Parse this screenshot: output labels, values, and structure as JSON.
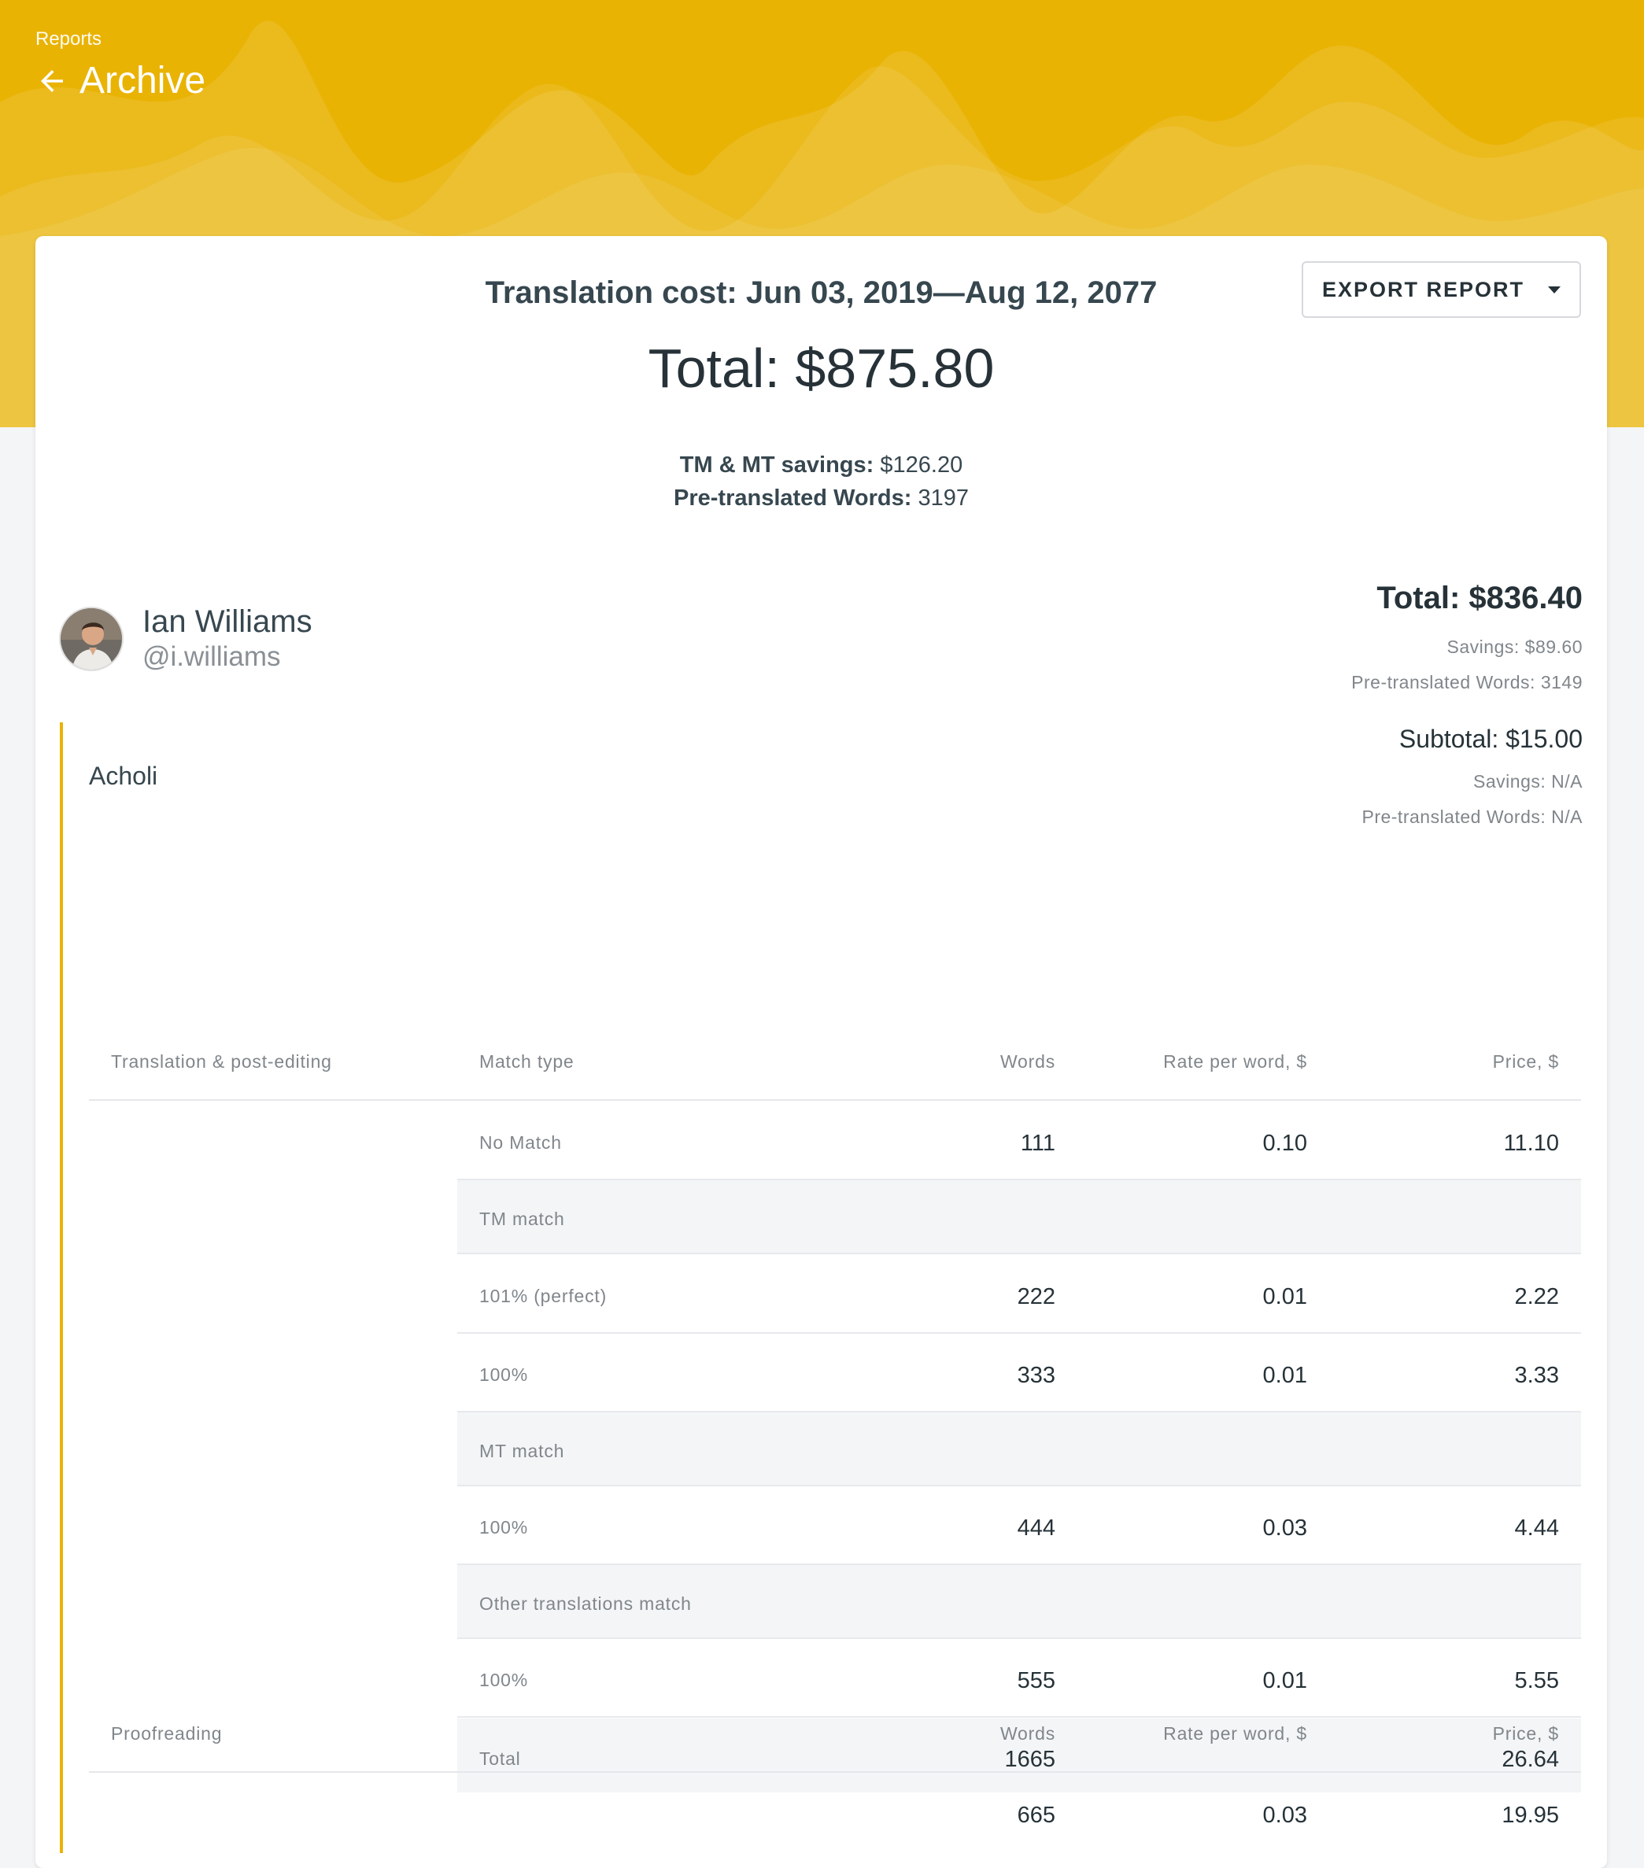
{
  "header": {
    "breadcrumb": "Reports",
    "title": "Archive",
    "accent_color": "#e9b304"
  },
  "report": {
    "export_label": "EXPORT REPORT",
    "cost_title": "Translation cost: Jun 03, 2019—Aug 12, 2077",
    "grand_total": "Total: $875.80",
    "savings_label": "TM & MT savings:",
    "savings_value": " $126.20",
    "pretranslated_label": "Pre-translated Words:",
    "pretranslated_value": " 3197"
  },
  "user": {
    "name": "Ian Williams",
    "handle": "@i.williams",
    "total": "Total: $836.40",
    "savings": "Savings: $89.60",
    "pretranslated": "Pre-translated Words: 3149"
  },
  "language": {
    "name": "Acholi",
    "subtotal": "Subtotal: $15.00",
    "savings": "Savings: N/A",
    "pretranslated": "Pre-translated Words: N/A"
  },
  "translation_table": {
    "headers": {
      "section": "Translation & post-editing",
      "match_type": "Match type",
      "words": "Words",
      "rate": "Rate per word, $",
      "price": "Price, $"
    },
    "rows": [
      {
        "label": "No Match",
        "words": "111",
        "rate": "0.10",
        "price": "11.10"
      },
      {
        "label": "TM match",
        "words": "",
        "rate": "",
        "price": ""
      },
      {
        "label": "101% (perfect)",
        "words": "222",
        "rate": "0.01",
        "price": "2.22"
      },
      {
        "label": "100%",
        "words": "333",
        "rate": "0.01",
        "price": "3.33"
      },
      {
        "label": "MT match",
        "words": "",
        "rate": "",
        "price": ""
      },
      {
        "label": "100%",
        "words": "444",
        "rate": "0.03",
        "price": "4.44"
      },
      {
        "label": "Other translations match",
        "words": "",
        "rate": "",
        "price": ""
      },
      {
        "label": "100%",
        "words": "555",
        "rate": "0.01",
        "price": "5.55"
      },
      {
        "label": "Total",
        "words": "1665",
        "rate": "",
        "price": "26.64"
      }
    ]
  },
  "proofreading_table": {
    "headers": {
      "section": "Proofreading",
      "words": "Words",
      "rate": "Rate per word, $",
      "price": "Price, $"
    },
    "row": {
      "words": "665",
      "rate": "0.03",
      "price": "19.95"
    }
  }
}
